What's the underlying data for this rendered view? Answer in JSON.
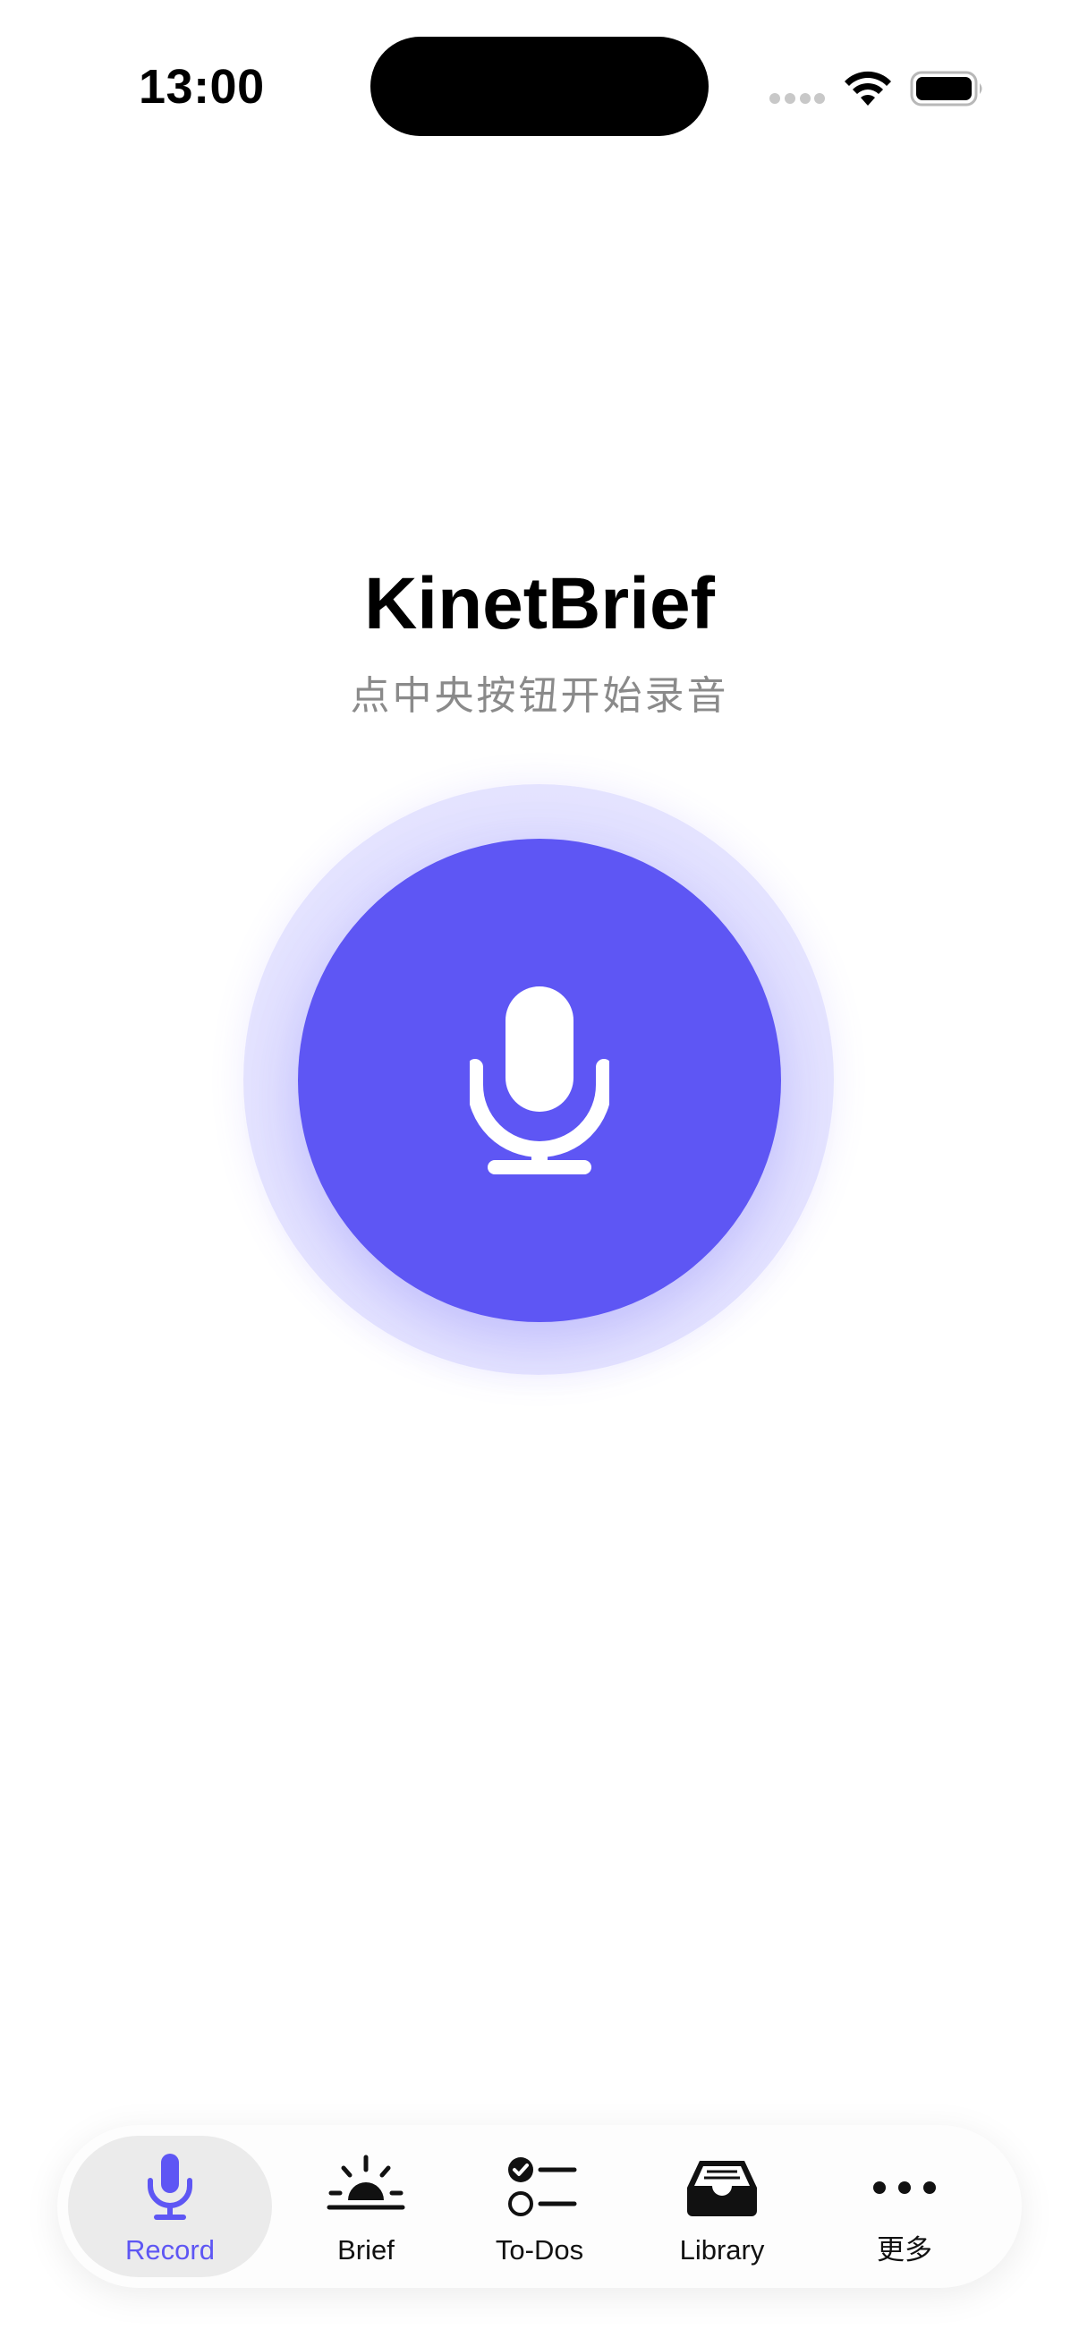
{
  "status_bar": {
    "time": "13:00"
  },
  "app": {
    "title": "KinetBrief",
    "subtitle": "点中央按钮开始录音"
  },
  "record_button": {
    "icon": "microphone-icon",
    "color": "#5e56f4"
  },
  "tab_bar": {
    "items": [
      {
        "label": "Record",
        "icon": "microphone-icon",
        "active": true
      },
      {
        "label": "Brief",
        "icon": "sunrise-icon",
        "active": false
      },
      {
        "label": "To-Dos",
        "icon": "checklist-icon",
        "active": false
      },
      {
        "label": "Library",
        "icon": "tray-icon",
        "active": false
      },
      {
        "label": "更多",
        "icon": "more-icon",
        "active": false
      }
    ],
    "accent_color": "#5e56f4"
  }
}
